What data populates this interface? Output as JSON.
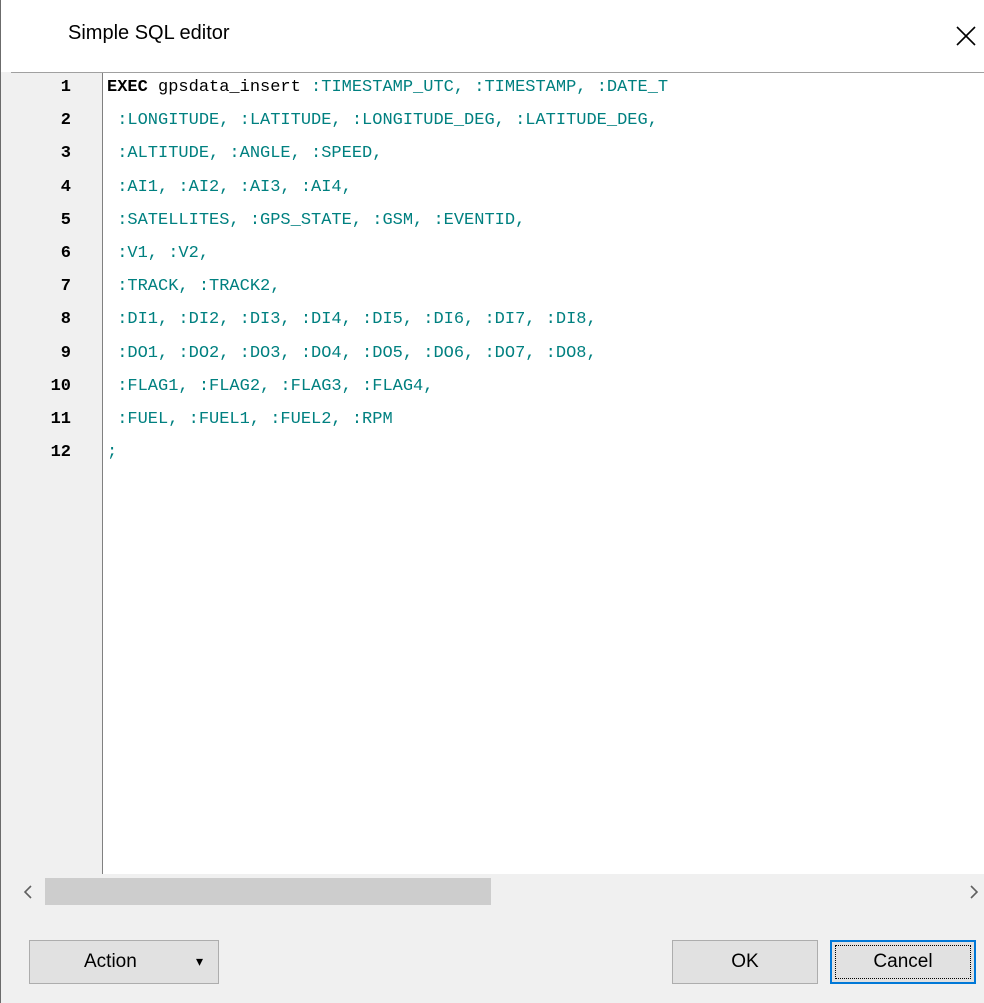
{
  "window": {
    "title": "Simple SQL editor"
  },
  "editor": {
    "line_numbers": [
      "1",
      "2",
      "3",
      "4",
      "5",
      "6",
      "7",
      "8",
      "9",
      "10",
      "11",
      "12"
    ],
    "lines": [
      {
        "keyword": "EXEC",
        "identifier": " gpsdata_insert",
        "rest": " :TIMESTAMP_UTC, :TIMESTAMP, :DATE_T"
      },
      {
        "keyword": "",
        "identifier": "",
        "rest": " :LONGITUDE, :LATITUDE, :LONGITUDE_DEG, :LATITUDE_DEG,"
      },
      {
        "keyword": "",
        "identifier": "",
        "rest": " :ALTITUDE, :ANGLE, :SPEED,"
      },
      {
        "keyword": "",
        "identifier": "",
        "rest": " :AI1, :AI2, :AI3, :AI4,"
      },
      {
        "keyword": "",
        "identifier": "",
        "rest": " :SATELLITES, :GPS_STATE, :GSM, :EVENTID,"
      },
      {
        "keyword": "",
        "identifier": "",
        "rest": " :V1, :V2,"
      },
      {
        "keyword": "",
        "identifier": "",
        "rest": " :TRACK, :TRACK2,"
      },
      {
        "keyword": "",
        "identifier": "",
        "rest": " :DI1, :DI2, :DI3, :DI4, :DI5, :DI6, :DI7, :DI8,"
      },
      {
        "keyword": "",
        "identifier": "",
        "rest": " :DO1, :DO2, :DO3, :DO4, :DO5, :DO6, :DO7, :DO8,"
      },
      {
        "keyword": "",
        "identifier": "",
        "rest": " :FLAG1, :FLAG2, :FLAG3, :FLAG4,"
      },
      {
        "keyword": "",
        "identifier": "",
        "rest": " :FUEL, :FUEL1, :FUEL2, :RPM"
      },
      {
        "keyword": "",
        "identifier": "",
        "rest": ";"
      }
    ]
  },
  "footer": {
    "action_label": "Action",
    "ok_label": "OK",
    "cancel_label": "Cancel"
  },
  "icons": {
    "close": "close-icon",
    "scroll_left": "chevron-left-icon",
    "scroll_right": "chevron-right-icon",
    "dropdown": "caret-down-icon"
  },
  "colors": {
    "code_text": "#008080",
    "keyword": "#000000",
    "focus_border": "#0078d7"
  }
}
